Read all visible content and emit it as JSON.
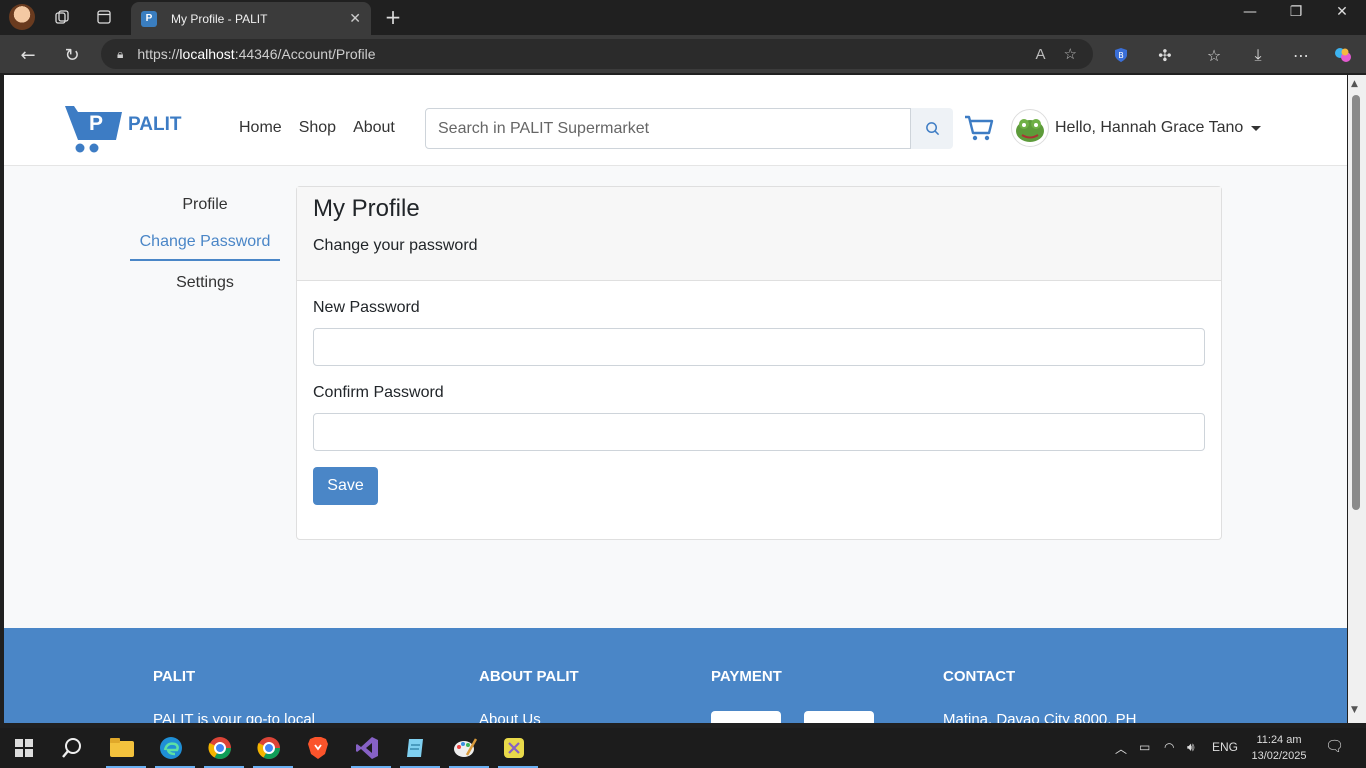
{
  "browser": {
    "tab_title": "My Profile - PALIT",
    "tab_favicon_letter": "P",
    "url_prefix": "https://",
    "url_host": "localhost",
    "url_rest": ":44346/Account/Profile"
  },
  "site": {
    "brand": "PALIT",
    "logo_letter": "P",
    "nav": {
      "home": "Home",
      "shop": "Shop",
      "about": "About"
    },
    "search_placeholder": "Search in PALIT Supermarket",
    "user_greeting": "Hello, Hannah Grace Tano"
  },
  "sidebar": {
    "items": [
      {
        "label": "Profile"
      },
      {
        "label": "Change Password",
        "active": true
      },
      {
        "label": "Settings"
      }
    ]
  },
  "card": {
    "title": "My Profile",
    "subtitle": "Change your password",
    "new_password_label": "New Password",
    "new_password_value": "",
    "confirm_password_label": "Confirm Password",
    "confirm_password_value": "",
    "save_label": "Save"
  },
  "footer": {
    "col1_title": "PALIT",
    "col1_text": "PALIT is your go-to local",
    "col2_title": "ABOUT PALIT",
    "col2_text": "About Us",
    "col3_title": "PAYMENT",
    "col4_title": "CONTACT",
    "col4_text": "Matina, Davao City 8000, PH"
  },
  "taskbar": {
    "lang": "ENG",
    "time": "11:24 am",
    "date": "13/02/2025"
  },
  "colors": {
    "accent": "#4a86c7",
    "brand_blue": "#3d7cc4",
    "page_bg": "#f8f9fa"
  }
}
